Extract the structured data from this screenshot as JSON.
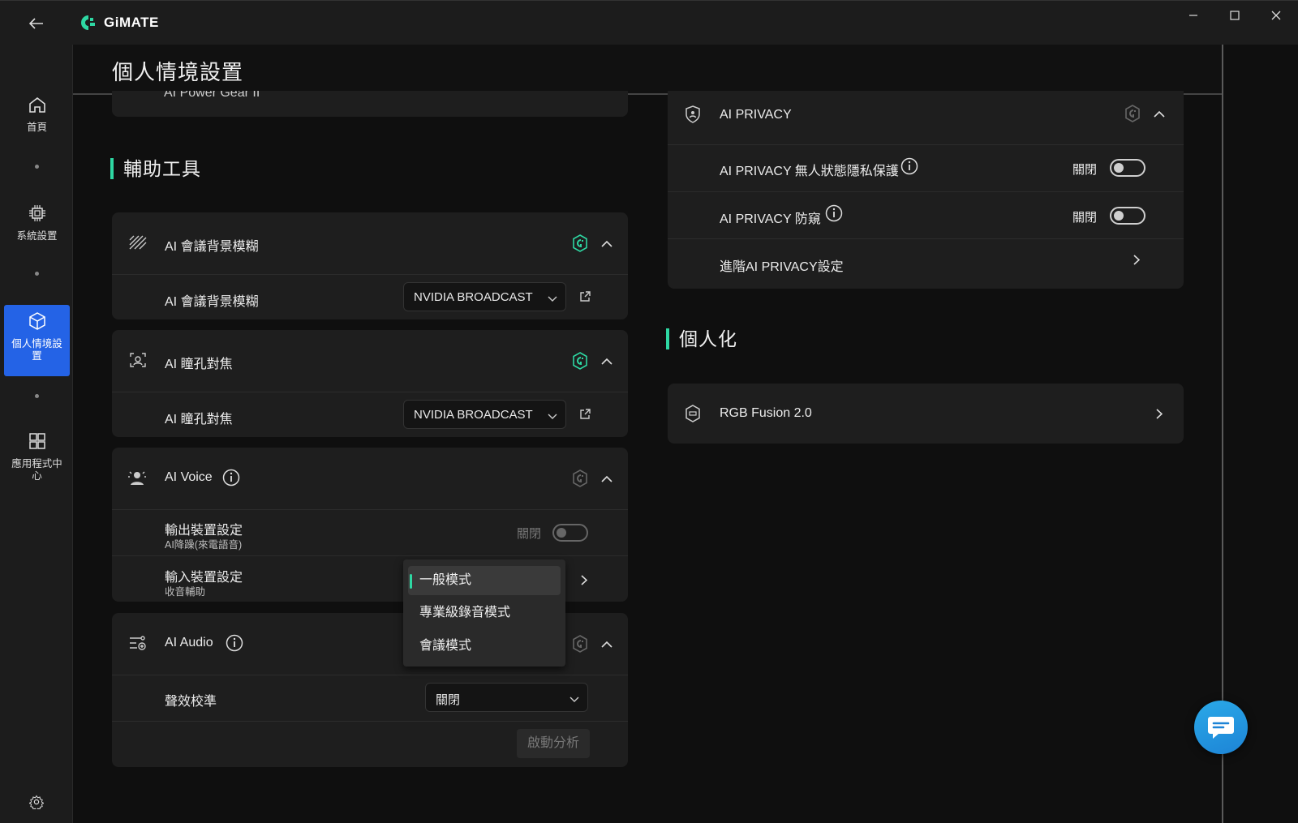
{
  "app": {
    "name": "GiMATE"
  },
  "page": {
    "title": "個人情境設置"
  },
  "sidebar": {
    "items": [
      {
        "label": "首頁",
        "icon": "home-icon"
      },
      {
        "label": "系統設置",
        "icon": "chip-icon"
      },
      {
        "label": "個人情境設置",
        "icon": "cube-icon",
        "active": true
      },
      {
        "label": "應用程式中心",
        "icon": "apps-grid-icon"
      }
    ]
  },
  "left": {
    "truncated_item": "AI Power Gear II",
    "section_title": "輔助工具",
    "blur_card": {
      "title": "AI 會議背景模糊",
      "row_label": "AI 會議背景模糊",
      "select_value": "NVIDIA BROADCAST"
    },
    "eye_card": {
      "title": "AI 瞳孔對焦",
      "row_label": "AI 瞳孔對焦",
      "select_value": "NVIDIA BROADCAST"
    },
    "voice_card": {
      "title": "AI Voice",
      "output_label": "輸出裝置設定",
      "output_sub": "AI降躁(來電語音)",
      "output_state": "關閉",
      "input_label": "輸入裝置設定",
      "input_sub": "收音輔助"
    },
    "audio_card": {
      "title": "AI Audio",
      "row_label": "聲效校準",
      "select_value": "關閉",
      "analyze_button": "啟動分析"
    },
    "dropdown": {
      "options": [
        "一般模式",
        "專業級錄音模式",
        "會議模式"
      ],
      "selected": "一般模式"
    }
  },
  "right": {
    "privacy_card": {
      "title": "AI PRIVACY",
      "rows": [
        {
          "label": "AI PRIVACY 無人狀態隱私保護",
          "state": "關閉"
        },
        {
          "label": "AI PRIVACY 防窺",
          "state": "關閉"
        }
      ],
      "advanced_link": "進階AI PRIVACY設定"
    },
    "section_title": "個人化",
    "rgb_card": {
      "title": "RGB Fusion 2.0"
    }
  },
  "colors": {
    "accent": "#2ed8a3",
    "active_nav": "#2463e6",
    "chat": "#1d84d6"
  }
}
